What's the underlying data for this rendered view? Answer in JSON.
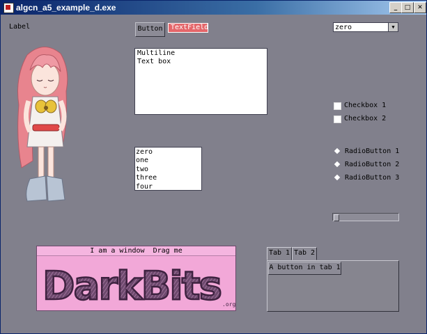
{
  "window": {
    "title": "algcn_a5_example_d.exe",
    "controls": {
      "minimize": "_",
      "maximize": "□",
      "close": "✕"
    }
  },
  "widgets": {
    "label": "Label",
    "button": "Button",
    "textfield": "TextField",
    "textbox": "Multiline\nText box",
    "listbox": [
      "zero",
      "one",
      "two",
      "three",
      "four"
    ],
    "dropdown": {
      "value": "zero",
      "arrow": "▼"
    },
    "checkboxes": [
      "Checkbox 1",
      "Checkbox 2"
    ],
    "radios": [
      "RadioButton 1",
      "RadioButton 2",
      "RadioButton 3"
    ],
    "slider": {
      "value": 0.0
    }
  },
  "drag_window": {
    "title": "I am a window  Drag me",
    "logo": "DarkBits",
    "logo_suffix": ".org"
  },
  "tabs": {
    "items": [
      "Tab 1",
      "Tab 2"
    ],
    "active": 0,
    "panel_button": "A button in tab 1"
  },
  "colors": {
    "background": "#81808c",
    "textfield": "#e4666a",
    "drag_window": "#f2a8d8",
    "logo": "#5e3a5e"
  },
  "icons": {
    "app": "app-icon",
    "dropdown": "chevron-down-icon",
    "radio": "diamond-radio-icon"
  }
}
